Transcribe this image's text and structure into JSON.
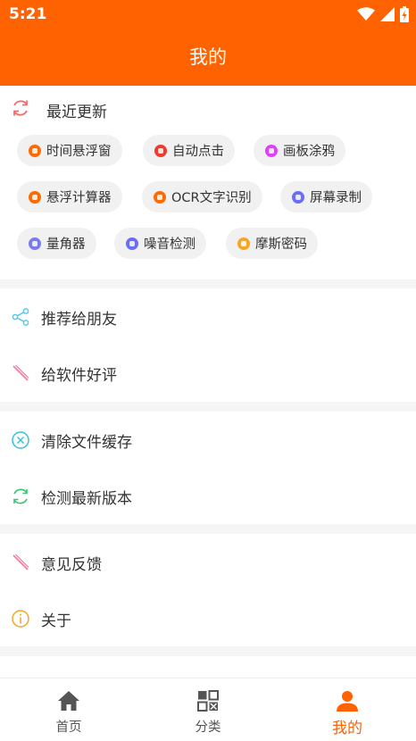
{
  "status": {
    "time": "5:21"
  },
  "header": {
    "title": "我的"
  },
  "recent": {
    "title": "最近更新",
    "chips": [
      {
        "label": "时间悬浮窗",
        "color": "#ff6a00"
      },
      {
        "label": "自动点击",
        "color": "#f03a2e"
      },
      {
        "label": "画板涂鸦",
        "color": "#e040fb"
      },
      {
        "label": "悬浮计算器",
        "color": "#ff6a00"
      },
      {
        "label": "OCR文字识别",
        "color": "#ff6a00"
      },
      {
        "label": "屏幕录制",
        "color": "#6b6ef5"
      },
      {
        "label": "量角器",
        "color": "#7b7bf0"
      },
      {
        "label": "噪音检测",
        "color": "#6b6ef5"
      },
      {
        "label": "摩斯密码",
        "color": "#f5a623"
      }
    ]
  },
  "menu": {
    "share": "推荐给朋友",
    "rate": "给软件好评",
    "clear_cache": "清除文件缓存",
    "check_update": "检测最新版本",
    "feedback": "意见反馈",
    "about": "关于"
  },
  "nav": {
    "home": "首页",
    "category": "分类",
    "mine": "我的"
  },
  "colors": {
    "accent": "#ff6200",
    "share_icon": "#5ec6e8",
    "pencil_icon": "#f07a9a",
    "clear_icon": "#36c2d8",
    "update_icon": "#37c37a",
    "about_icon": "#f5a623"
  }
}
